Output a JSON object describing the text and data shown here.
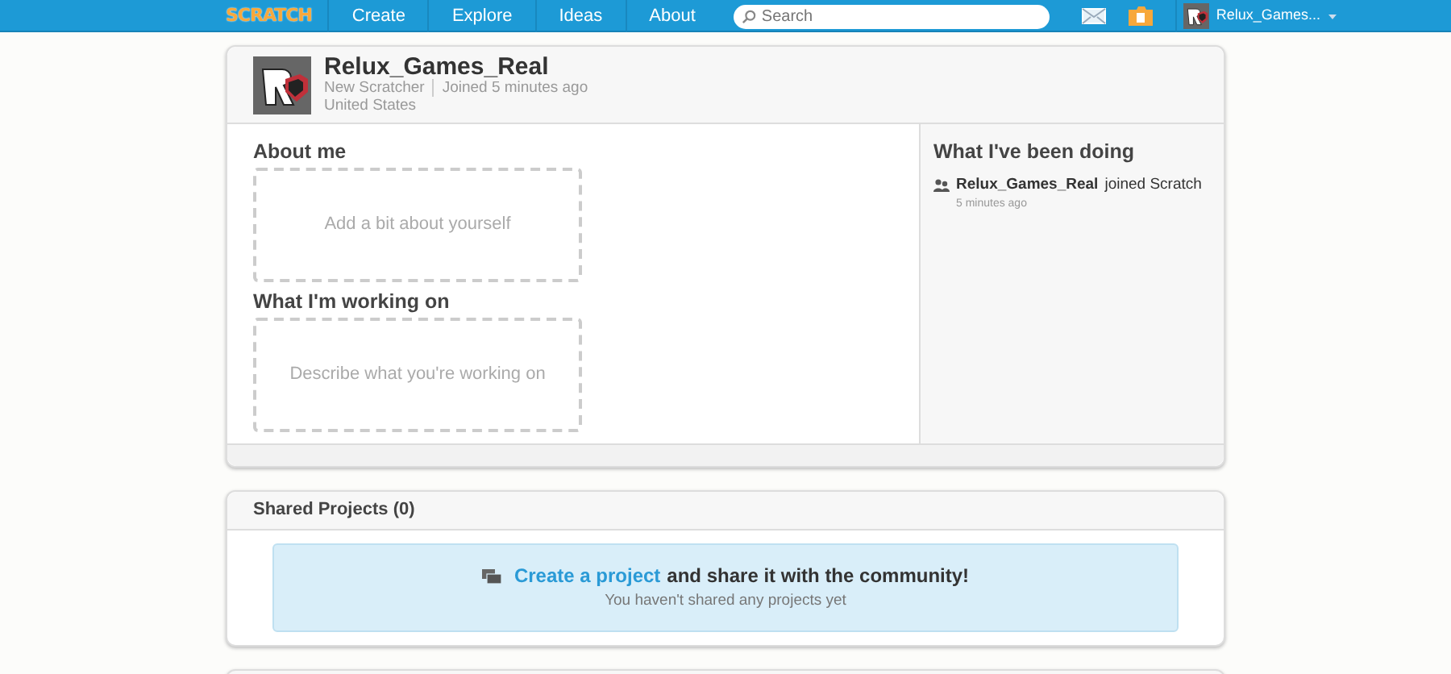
{
  "nav": {
    "logo": "SCRATCH",
    "links": [
      "Create",
      "Explore",
      "Ideas",
      "About"
    ],
    "search": {
      "placeholder": "Search"
    },
    "user": "Relux_Games..."
  },
  "profile": {
    "username": "Relux_Games_Real",
    "rank": "New Scratcher",
    "joined": "Joined 5 minutes ago",
    "location": "United States"
  },
  "about": {
    "title": "About me",
    "placeholder": "Add a bit about yourself"
  },
  "working": {
    "title": "What I'm working on",
    "placeholder": "Describe what you're working on"
  },
  "activity": {
    "title": "What I've been doing",
    "items": [
      {
        "actor": "Relux_Games_Real",
        "action": "joined Scratch",
        "time": "5 minutes ago"
      }
    ]
  },
  "shared": {
    "title": "Shared Projects (0)",
    "link": "Create a project",
    "message": "and share it with the community!",
    "note": "You haven't shared any projects yet"
  }
}
